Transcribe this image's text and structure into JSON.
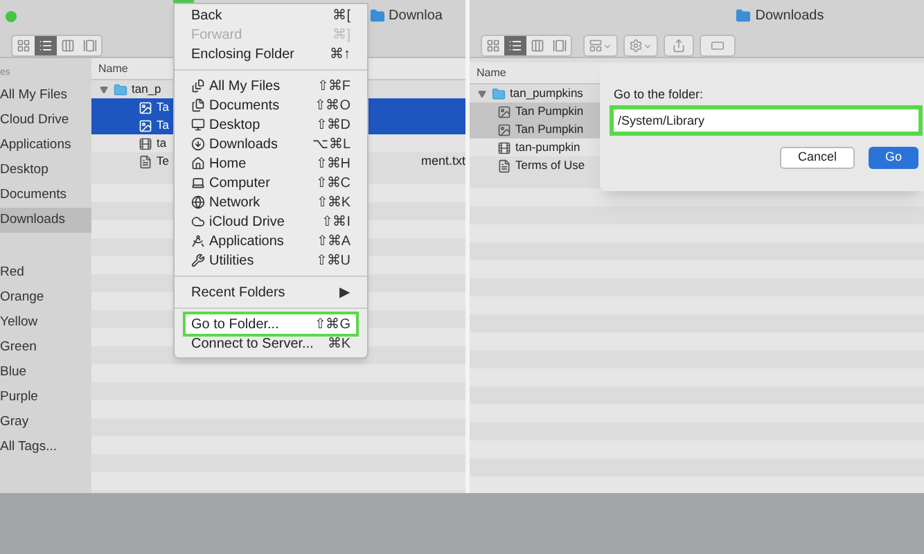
{
  "left_window": {
    "title": "Downloa",
    "sidebar": {
      "section_header": "es",
      "favorites": [
        {
          "label": "All My Files",
          "selected": false
        },
        {
          "label": "Cloud Drive",
          "selected": false
        },
        {
          "label": "Applications",
          "selected": false
        },
        {
          "label": "Desktop",
          "selected": false
        },
        {
          "label": "Documents",
          "selected": false
        },
        {
          "label": "Downloads",
          "selected": true
        }
      ],
      "tags": [
        "Red",
        "Orange",
        "Yellow",
        "Green",
        "Blue",
        "Purple",
        "Gray",
        "All Tags..."
      ]
    },
    "file_list": {
      "column": "Name",
      "rows": [
        {
          "name": "tan_p",
          "kind": "folder",
          "selected": false
        },
        {
          "name": "Ta",
          "kind": "image",
          "selected": true
        },
        {
          "name": "Ta",
          "kind": "image",
          "selected": true
        },
        {
          "name": "ta",
          "kind": "video",
          "selected": false
        },
        {
          "name": "Te",
          "tail": "ment.txt",
          "kind": "text",
          "selected": false
        }
      ]
    }
  },
  "go_menu": {
    "history": [
      {
        "label": "Back",
        "shortcut": "⌘[",
        "disabled": false
      },
      {
        "label": "Forward",
        "shortcut": "⌘]",
        "disabled": true
      },
      {
        "label": "Enclosing Folder",
        "shortcut": "⌘↑",
        "disabled": false
      }
    ],
    "places": [
      {
        "label": "All My Files",
        "shortcut": "⇧⌘F"
      },
      {
        "label": "Documents",
        "shortcut": "⇧⌘O"
      },
      {
        "label": "Desktop",
        "shortcut": "⇧⌘D"
      },
      {
        "label": "Downloads",
        "shortcut": "⌥⌘L"
      },
      {
        "label": "Home",
        "shortcut": "⇧⌘H"
      },
      {
        "label": "Computer",
        "shortcut": "⇧⌘C"
      },
      {
        "label": "Network",
        "shortcut": "⇧⌘K"
      },
      {
        "label": "iCloud Drive",
        "shortcut": "⇧⌘I"
      },
      {
        "label": "Applications",
        "shortcut": "⇧⌘A"
      },
      {
        "label": "Utilities",
        "shortcut": "⇧⌘U"
      }
    ],
    "recent": {
      "label": "Recent Folders",
      "arrow": "▶"
    },
    "actions": [
      {
        "label": "Go to Folder...",
        "shortcut": "⇧⌘G",
        "highlighted": true
      },
      {
        "label": "Connect to Server...",
        "shortcut": "⌘K",
        "highlighted": false
      }
    ]
  },
  "right_window": {
    "title": "Downloads",
    "file_list": {
      "column": "Name",
      "rows": [
        {
          "name": "tan_pumpkins",
          "kind": "folder",
          "selected": false
        },
        {
          "name": "Tan Pumpkin",
          "kind": "image",
          "selected": true
        },
        {
          "name": "Tan Pumpkin",
          "kind": "image",
          "selected": true
        },
        {
          "name": "tan-pumpkin",
          "kind": "video",
          "selected": false
        },
        {
          "name": "Terms of Use",
          "kind": "text",
          "selected": false
        }
      ]
    },
    "dialog": {
      "label": "Go to the folder:",
      "value": "/System/Library",
      "highlighted": true,
      "buttons": [
        {
          "label": "Cancel",
          "kind": "secondary"
        },
        {
          "label": "Go",
          "kind": "default"
        }
      ]
    }
  }
}
